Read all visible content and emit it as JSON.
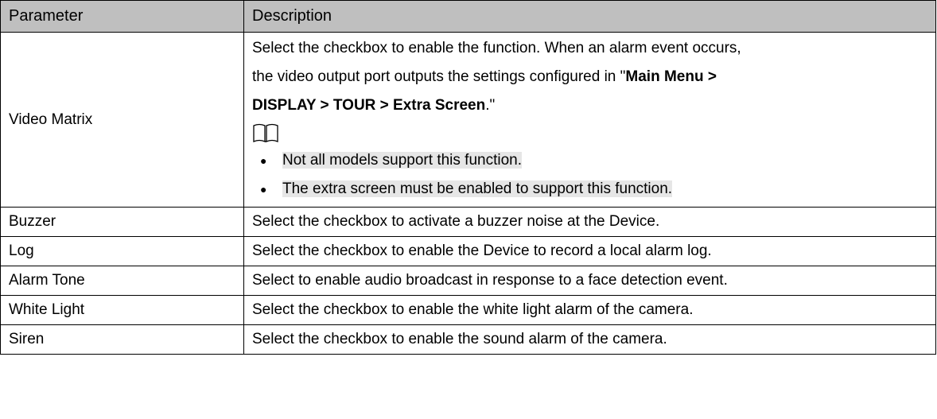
{
  "table": {
    "headers": {
      "parameter": "Parameter",
      "description": "Description"
    },
    "video_matrix": {
      "parameter": "Video Matrix",
      "line1": "Select the checkbox to enable the function. When an alarm event occurs,",
      "line2_prefix": "the video output port outputs the settings configured in \"",
      "line2_bold": "Main Menu >",
      "line3_bold": "DISPLAY > TOUR > Extra Screen",
      "line3_suffix": ".\"",
      "note_icon": "book-icon",
      "notes": [
        "Not all models support this function.",
        "The extra screen must be enabled to support this function."
      ],
      "bullet": "●"
    },
    "rows": [
      {
        "parameter": "Buzzer",
        "description": "Select the checkbox to activate a buzzer noise at the Device."
      },
      {
        "parameter": "Log",
        "description": "Select the checkbox to enable the Device to record a local alarm log."
      },
      {
        "parameter": "Alarm Tone",
        "description": "Select to enable audio broadcast in response to a face detection event."
      },
      {
        "parameter": "White Light",
        "description": "Select the checkbox to enable the white light alarm of the camera."
      },
      {
        "parameter": "Siren",
        "description": "Select the checkbox to enable the sound alarm of the camera."
      }
    ]
  },
  "colors": {
    "header_bg": "#bfbfbf",
    "note_highlight": "#e6e6e6"
  }
}
